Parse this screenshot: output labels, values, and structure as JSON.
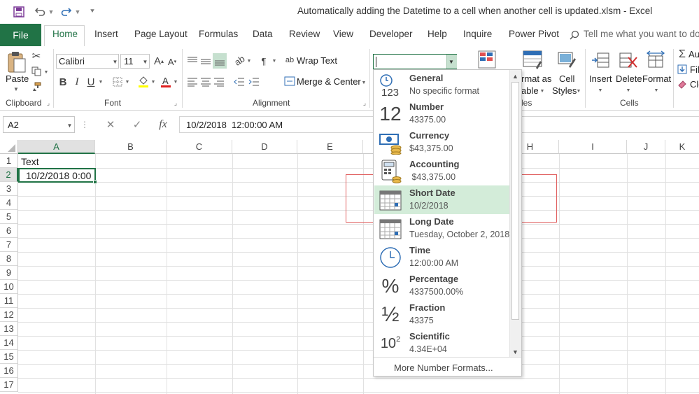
{
  "title": "Automatically adding the Datetime to a cell when another cell is updated.xlsm  -  Excel",
  "tabs": [
    "File",
    "Home",
    "Insert",
    "Page Layout",
    "Formulas",
    "Data",
    "Review",
    "View",
    "Developer",
    "Help",
    "Inquire",
    "Power Pivot"
  ],
  "tell_me": "Tell me what you want to do",
  "ribbon": {
    "paste": "Paste",
    "clipboard": "Clipboard",
    "font_name": "Calibri",
    "font_size": "11",
    "font": "Font",
    "bold": "B",
    "italic": "I",
    "underline": "U",
    "wrap_text": "Wrap Text",
    "merge_center": "Merge & Center",
    "alignment": "Alignment",
    "format_as_table_1": "rmat as",
    "format_as_table_2": "able",
    "cell_styles_1": "Cell",
    "cell_styles_2": "Styles",
    "styles_tail": "les",
    "insert": "Insert",
    "delete": "Delete",
    "format": "Format",
    "cells": "Cells",
    "autosum": "Au",
    "fill": "Fill",
    "clear": "Cle"
  },
  "formula_bar": {
    "name_box": "A2",
    "cancel": "✕",
    "enter": "✓",
    "fx": "fx",
    "content": "10/2/2018  12:00:00 AM"
  },
  "columns": [
    "A",
    "B",
    "C",
    "D",
    "E",
    "H",
    "I",
    "J",
    "K"
  ],
  "rows": [
    "1",
    "2",
    "3",
    "4",
    "5",
    "6",
    "7",
    "8",
    "9",
    "10",
    "11",
    "12",
    "13",
    "14",
    "15",
    "16",
    "17"
  ],
  "cells": {
    "A1": "Text",
    "A2": "10/2/2018 0:00"
  },
  "number_formats": [
    {
      "name": "General",
      "example": "No specific format",
      "icon": "general-123-icon"
    },
    {
      "name": "Number",
      "example": "43375.00",
      "icon": "number-12-icon"
    },
    {
      "name": "Currency",
      "example": "$43,375.00",
      "icon": "currency-icon"
    },
    {
      "name": "Accounting",
      "example": " $43,375.00",
      "icon": "accounting-icon"
    },
    {
      "name": "Short Date",
      "example": "10/2/2018",
      "icon": "calendar-icon"
    },
    {
      "name": "Long Date",
      "example": "Tuesday, October 2, 2018",
      "icon": "calendar-icon"
    },
    {
      "name": "Time",
      "example": "12:00:00 AM",
      "icon": "clock-icon"
    },
    {
      "name": "Percentage",
      "example": "4337500.00%",
      "icon": "percent-icon"
    },
    {
      "name": "Fraction",
      "example": "43375",
      "icon": "fraction-icon"
    },
    {
      "name": "Scientific",
      "example": "4.34E+04",
      "icon": "scientific-icon"
    }
  ],
  "more_formats": "More Number Formats...",
  "glyphs": {
    "n12": "12",
    "n123": "123",
    "pct": "%",
    "half": "½",
    "ten": "10",
    "two": "2",
    "sigma": "Σ"
  },
  "colors": {
    "excel_green": "#217346",
    "highlight": "#d3ecd9",
    "red_annotation": "#e06060"
  }
}
